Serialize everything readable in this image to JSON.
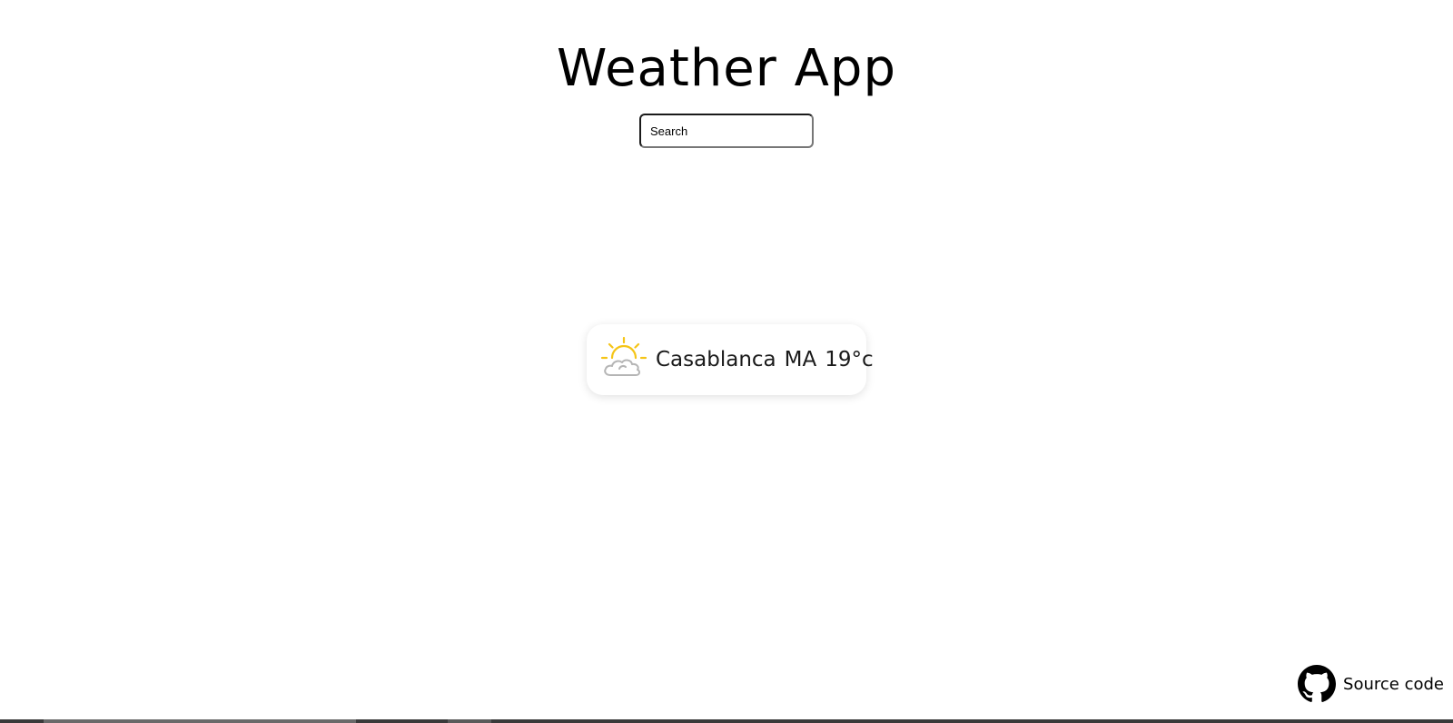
{
  "app": {
    "title": "Weather App"
  },
  "search": {
    "placeholder": "Search",
    "value": ""
  },
  "weather": {
    "icon": "partly-cloudy-icon",
    "city": "Casablanca",
    "country": "MA",
    "temperature": "19°c"
  },
  "footer": {
    "link_label": "Source code",
    "icon": "github-icon"
  },
  "colors": {
    "sun": "#f5c518",
    "cloud": "#b5b5b5",
    "text": "#000000",
    "background": "#ffffff"
  }
}
